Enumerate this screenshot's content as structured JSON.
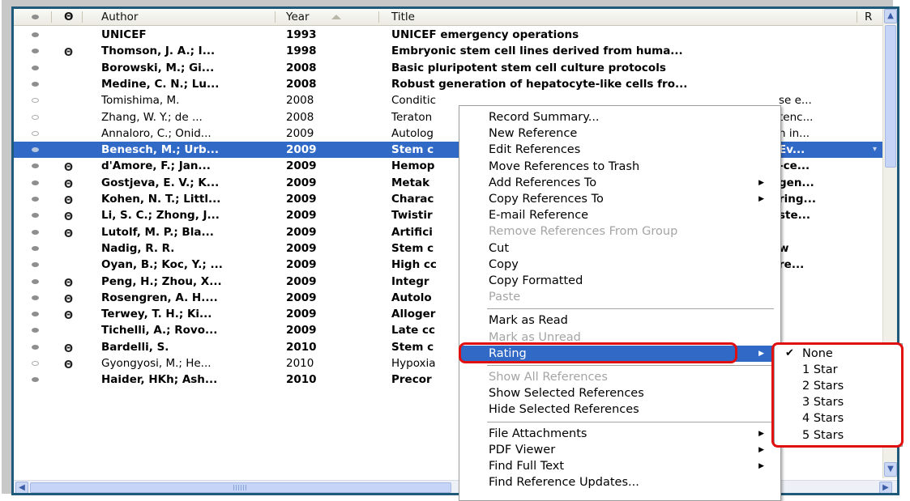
{
  "columns": {
    "read": "",
    "attachment": "",
    "author": "Author",
    "year": "Year",
    "title": "Title",
    "rating": "R"
  },
  "rows": [
    {
      "read": true,
      "attach": false,
      "bold": true,
      "author": "UNICEF",
      "year": "1993",
      "title": "UNICEF emergency operations"
    },
    {
      "read": true,
      "attach": true,
      "bold": true,
      "author": "Thomson, J. A.; I...",
      "year": "1998",
      "title": "Embryonic stem cell lines derived from huma..."
    },
    {
      "read": true,
      "attach": false,
      "bold": true,
      "author": "Borowski, M.; Gi...",
      "year": "2008",
      "title": "Basic pluripotent stem cell culture protocols"
    },
    {
      "read": true,
      "attach": false,
      "bold": true,
      "author": "Medine, C. N.; Lu...",
      "year": "2008",
      "title": "Robust generation of hepatocyte-like cells fro..."
    },
    {
      "read": false,
      "attach": false,
      "bold": false,
      "author": "Tomishima, M.",
      "year": "2008",
      "title": "Conditic",
      "title_tail": "se e..."
    },
    {
      "read": false,
      "attach": false,
      "bold": false,
      "author": "Zhang, W. Y.; de ...",
      "year": "2008",
      "title": "Teraton",
      "title_tail": "tenc..."
    },
    {
      "read": false,
      "attach": false,
      "bold": false,
      "author": "Annaloro, C.; Onid...",
      "year": "2009",
      "title": "Autolog",
      "title_tail": "n in..."
    },
    {
      "read": true,
      "attach": false,
      "bold": true,
      "author": "Benesch, M.; Urb...",
      "year": "2009",
      "title": "Stem c",
      "title_tail": "Ev...",
      "selected": true
    },
    {
      "read": true,
      "attach": true,
      "bold": true,
      "author": "d'Amore, F.; Jan...",
      "year": "2009",
      "title": "Hemop",
      "title_tail": "-ce..."
    },
    {
      "read": true,
      "attach": true,
      "bold": true,
      "author": "Gostjeva, E. V.; K...",
      "year": "2009",
      "title": "Metak",
      "title_tail": "gen..."
    },
    {
      "read": true,
      "attach": true,
      "bold": true,
      "author": "Kohen, N. T.; Littl...",
      "year": "2009",
      "title": "Charac",
      "title_tail": "ring..."
    },
    {
      "read": true,
      "attach": true,
      "bold": true,
      "author": "Li, S. C.; Zhong, J...",
      "year": "2009",
      "title": "Twistir",
      "title_tail": "ste..."
    },
    {
      "read": true,
      "attach": true,
      "bold": true,
      "author": "Lutolf, M. P.; Bla...",
      "year": "2009",
      "title": "Artifici",
      "title_tail": ""
    },
    {
      "read": true,
      "attach": false,
      "bold": true,
      "author": "Nadig, R. R.",
      "year": "2009",
      "title": "Stem c",
      "title_tail": "w"
    },
    {
      "read": true,
      "attach": false,
      "bold": true,
      "author": "Oyan, B.; Koc, Y.; ...",
      "year": "2009",
      "title": "High cc",
      "title_tail": "re..."
    },
    {
      "read": true,
      "attach": true,
      "bold": true,
      "author": "Peng, H.; Zhou, X...",
      "year": "2009",
      "title": "Integr",
      "title_tail": ""
    },
    {
      "read": true,
      "attach": true,
      "bold": true,
      "author": "Rosengren, A. H....",
      "year": "2009",
      "title": "Autolo",
      "title_tail": ""
    },
    {
      "read": true,
      "attach": true,
      "bold": true,
      "author": "Terwey, T. H.; Ki...",
      "year": "2009",
      "title": "Alloger",
      "title_tail": ""
    },
    {
      "read": true,
      "attach": false,
      "bold": true,
      "author": "Tichelli, A.; Rovo...",
      "year": "2009",
      "title": "Late cc",
      "title_tail": ""
    },
    {
      "read": true,
      "attach": true,
      "bold": true,
      "author": "Bardelli, S.",
      "year": "2010",
      "title": "Stem c",
      "title_tail": ""
    },
    {
      "read": false,
      "attach": true,
      "bold": false,
      "author": "Gyongyosi, M.; He...",
      "year": "2010",
      "title": "Hypoxia",
      "title_tail": ""
    },
    {
      "read": true,
      "attach": false,
      "bold": true,
      "author": "Haider, HKh; Ash...",
      "year": "2010",
      "title": "Precor",
      "title_tail": ""
    }
  ],
  "context_menu": [
    {
      "label": "Record Summary...",
      "disabled": false
    },
    {
      "label": "New Reference",
      "disabled": false
    },
    {
      "label": "Edit References",
      "disabled": false
    },
    {
      "label": "Move References to Trash",
      "disabled": false
    },
    {
      "label": "Add References To",
      "disabled": false,
      "submenu": true
    },
    {
      "label": "Copy References To",
      "disabled": false,
      "submenu": true
    },
    {
      "label": "E-mail Reference",
      "disabled": false
    },
    {
      "label": "Remove References From Group",
      "disabled": true
    },
    {
      "label": "Cut",
      "disabled": false
    },
    {
      "label": "Copy",
      "disabled": false
    },
    {
      "label": "Copy Formatted",
      "disabled": false
    },
    {
      "label": "Paste",
      "disabled": true
    },
    {
      "separator": true
    },
    {
      "label": "Mark as Read",
      "disabled": false
    },
    {
      "label": "Mark as Unread",
      "disabled": true
    },
    {
      "label": "Rating",
      "disabled": false,
      "submenu": true,
      "active": true
    },
    {
      "separator": true
    },
    {
      "label": "Show All References",
      "disabled": true
    },
    {
      "label": "Show Selected References",
      "disabled": false
    },
    {
      "label": "Hide Selected References",
      "disabled": false
    },
    {
      "separator": true
    },
    {
      "label": "File Attachments",
      "disabled": false,
      "submenu": true
    },
    {
      "label": "PDF Viewer",
      "disabled": false,
      "submenu": true
    },
    {
      "label": "Find Full Text",
      "disabled": false,
      "submenu": true
    },
    {
      "label": "Find Reference Updates...",
      "disabled": false
    }
  ],
  "rating_submenu": {
    "items": [
      "None",
      "1 Star",
      "2 Stars",
      "3 Stars",
      "4 Stars",
      "5 Stars"
    ],
    "checked": "None"
  },
  "colors": {
    "selection": "#3169c6",
    "highlight_box": "#e01010",
    "frame": "#1f5a7a"
  },
  "icons": {
    "attachment": "paperclip-icon",
    "read": "read-dot-icon",
    "unread": "unread-dot-icon",
    "submenu_arrow": "triangle-right-icon",
    "check": "checkmark-icon"
  }
}
